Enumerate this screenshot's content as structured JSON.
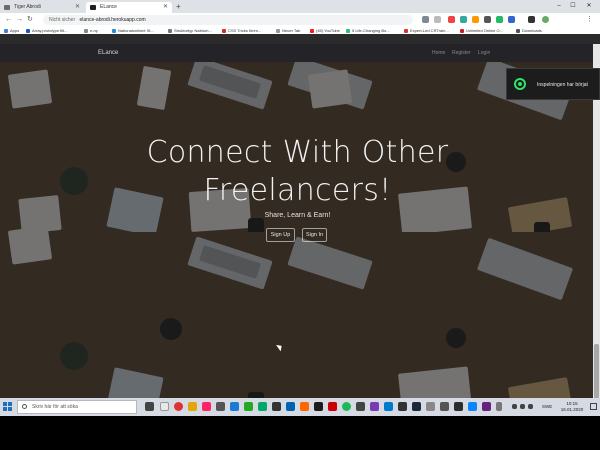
{
  "browser": {
    "tabs": [
      {
        "title": "Tiger Abrodi",
        "active": false
      },
      {
        "title": "ELance",
        "active": true
      }
    ],
    "address": {
      "security_label": "Nicht sicher",
      "url": "elance-abrodi.herokuapp.com"
    },
    "bookmarks": [
      "Apps",
      "Array.prototype.filt...",
      "e-ny",
      "Nationalonlineé St...",
      "Strukturtyp Natrium...",
      "CSS Tricks förén...",
      "Neuer Tab",
      "(45) YouTube",
      "5 Life-Changing Bo...",
      "Expert-Led CRTrain...",
      "Unlimited Online O...",
      "Downloads"
    ]
  },
  "site": {
    "brand": "ELance",
    "nav_links": [
      "Home",
      "Register",
      "Login"
    ],
    "hero": {
      "title": "Connect With Other Freelancers!",
      "subtitle": "Share, Learn & Earn!",
      "signup_label": "Sign Up",
      "signin_label": "Sign In"
    }
  },
  "recording": {
    "label": "Inspelningen har börjat",
    "accent": "#32e36b"
  },
  "taskbar": {
    "search_placeholder": "Skriv här för att söka",
    "language": "SWE",
    "time": "10:15",
    "date": "16.01.2020"
  }
}
